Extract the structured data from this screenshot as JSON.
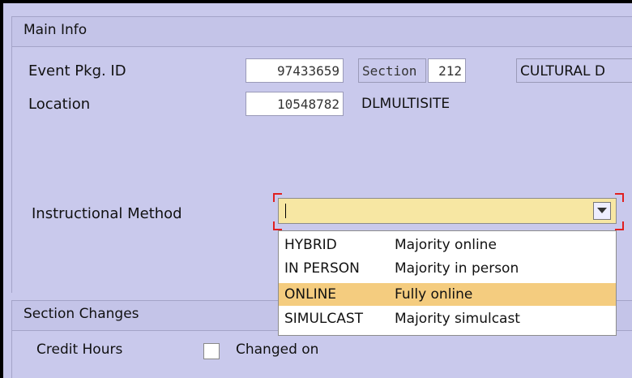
{
  "main_info": {
    "title": "Main Info",
    "event_pkg_label": "Event Pkg. ID",
    "event_pkg_id": "97433659",
    "section_label": "Section",
    "section_value": "212",
    "title_value": "CULTURAL D",
    "location_label": "Location",
    "location_id": "10548782",
    "location_name": "DLMULTISITE",
    "instructional_method_label": "Instructional Method",
    "instructional_method_value": ""
  },
  "dropdown_options": [
    {
      "code": "HYBRID",
      "desc": "Majority online"
    },
    {
      "code": "IN PERSON",
      "desc": "Majority in person"
    },
    {
      "code": "ONLINE",
      "desc": "Fully online"
    },
    {
      "code": "SIMULCAST",
      "desc": "Majority simulcast"
    }
  ],
  "section_changes": {
    "title": "Section Changes",
    "credit_hours_label": "Credit Hours",
    "changed_on_label": "Changed on"
  },
  "colors": {
    "background": "#c9c9ec",
    "dropdown_bg": "#f7e7a3",
    "selected_option": "#f4cc7f",
    "focus": "#e02020"
  }
}
